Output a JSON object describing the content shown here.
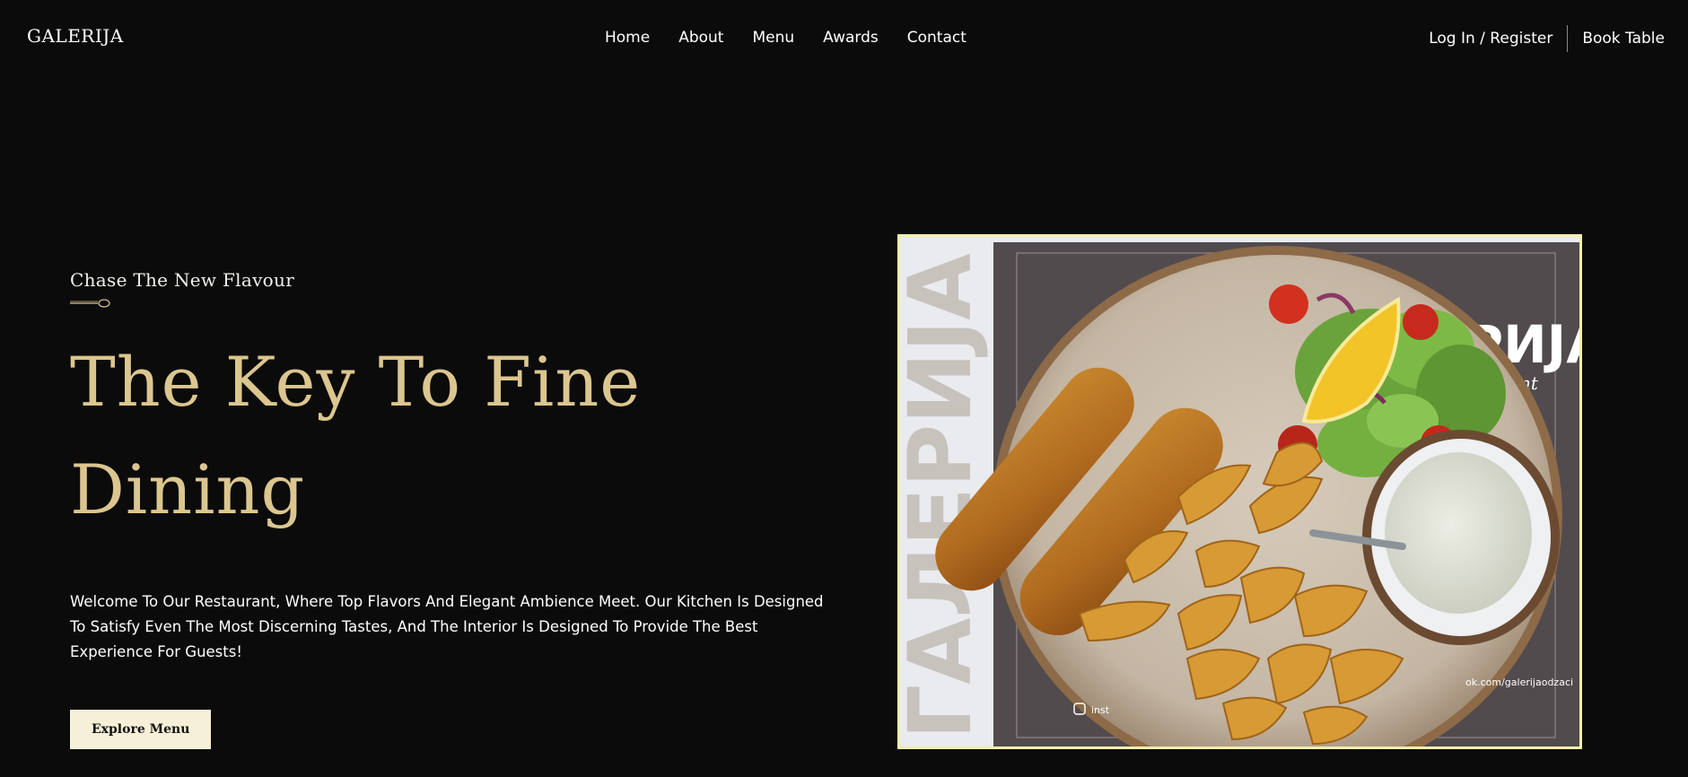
{
  "header": {
    "logo": "GALERIJA",
    "nav": [
      "Home",
      "About",
      "Menu",
      "Awards",
      "Contact"
    ],
    "login": "Log In / Register",
    "book": "Book Table"
  },
  "hero": {
    "tagline": "Chase The New Flavour",
    "headline": "The Key To Fine Dining",
    "intro": "Welcome To Our Restaurant, Where Top Flavors And Elegant Ambience Meet. Our Kitchen Is Designed To Satisfy Even The Most Discerning Tastes, And The Interior Is Designed To Provide The Best Experience For Guests!",
    "cta": "Explore Menu"
  },
  "image": {
    "placemat_word": "ГАЛЕРИЈА",
    "placemat_logo": "ЕРИЈА",
    "placemat_sub": "nt",
    "facebook": "ok.com/galerijaodzaci",
    "instagram": "inst"
  },
  "colors": {
    "background": "#0b0b0c",
    "accent": "#dcc68f",
    "button": "#f7f0d8",
    "image_border": "#f4eeaa"
  }
}
